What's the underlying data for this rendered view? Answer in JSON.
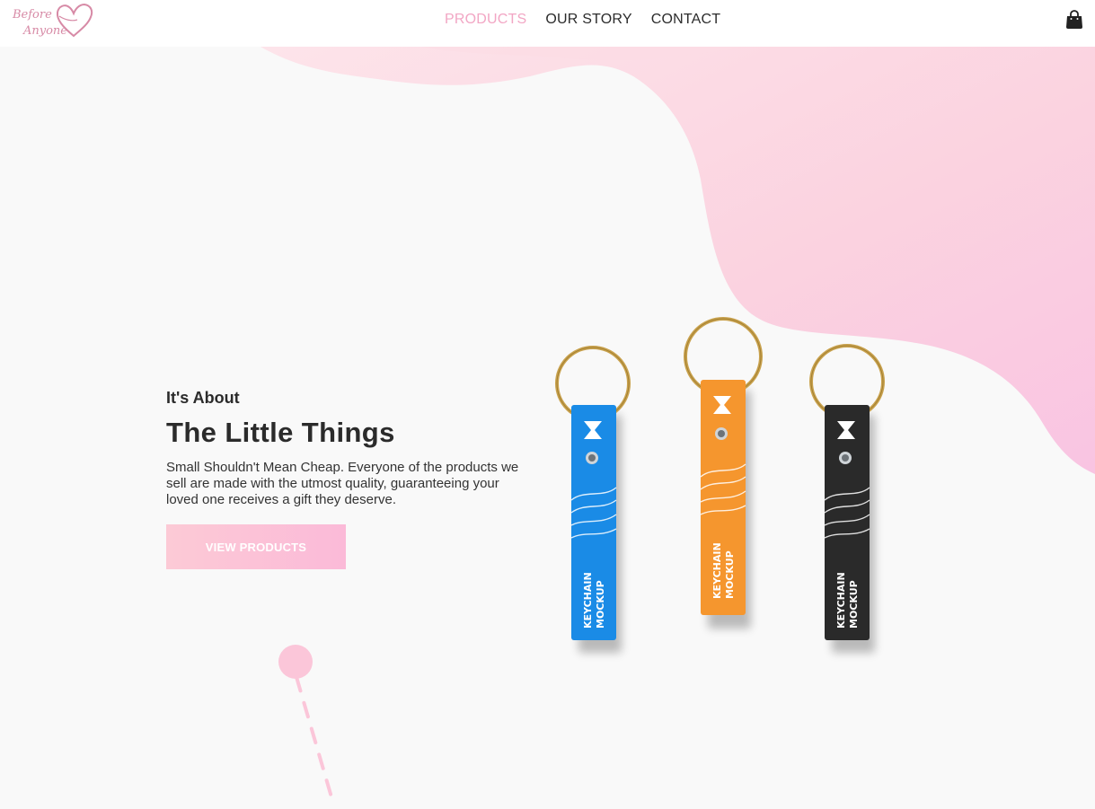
{
  "brand": {
    "logo_line1": "Before",
    "logo_line2": "Anyone"
  },
  "nav": {
    "items": [
      "PRODUCTS",
      "OUR STORY",
      "CONTACT"
    ],
    "active": "PRODUCTS"
  },
  "cart": {
    "icon": "shopping-bag-icon"
  },
  "hero": {
    "eyebrow": "It's About",
    "title": "The Little Things",
    "description": "Small Shouldn't Mean Cheap. Everyone of the products we sell are made with the utmost quality, guaranteeing your loved one receives a gift they deserve.",
    "cta_label": "VIEW PRODUCTS"
  },
  "product_image": {
    "keychains": [
      {
        "color": "#1a8be6",
        "label_line1": "KEYCHAIN",
        "label_line2": "MOCKUP"
      },
      {
        "color": "#f5962e",
        "label_line1": "KEYCHAIN",
        "label_line2": "MOCKUP"
      },
      {
        "color": "#2a2a2a",
        "label_line1": "KEYCHAIN",
        "label_line2": "MOCKUP"
      }
    ]
  },
  "colors": {
    "accent_pink": "#f2a6c4",
    "background": "#f9f9f9",
    "text": "#2b2b2b"
  }
}
